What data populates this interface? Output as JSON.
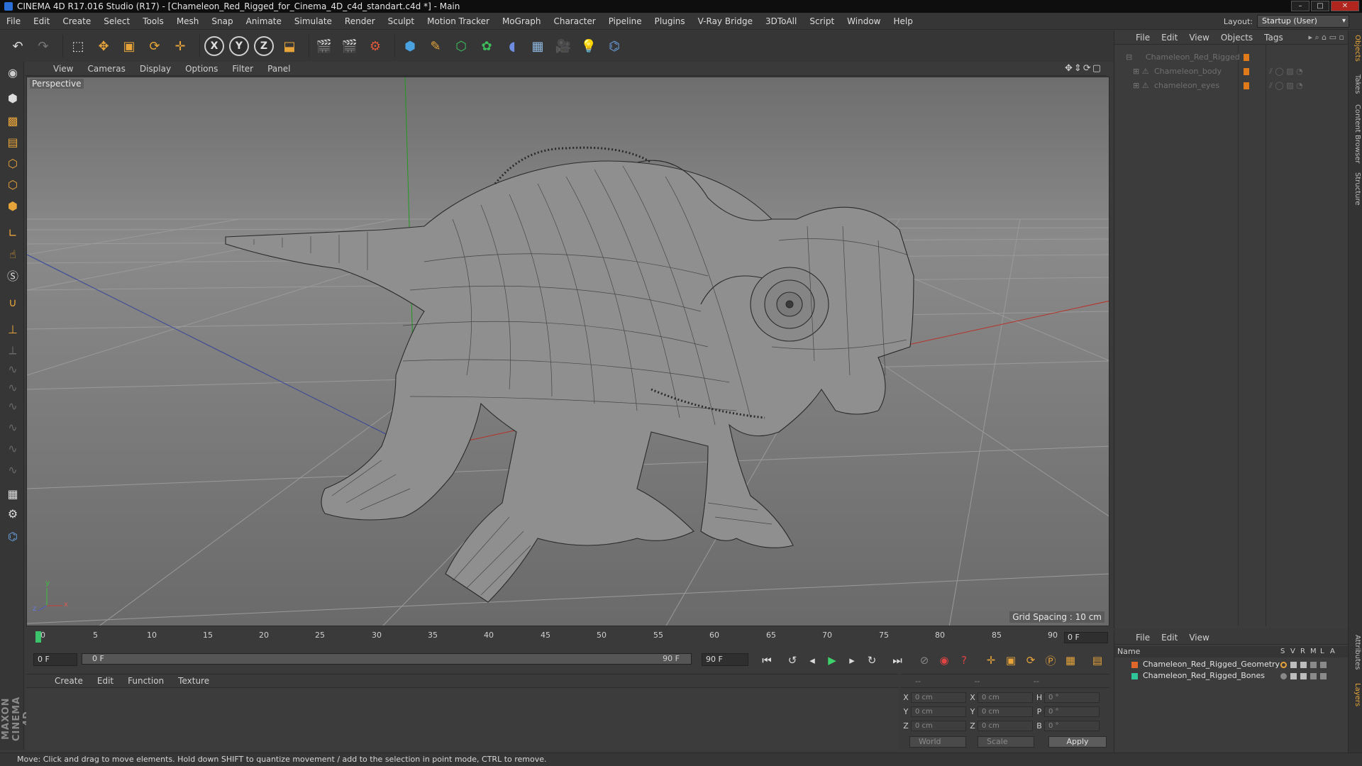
{
  "window": {
    "title": "CINEMA 4D R17.016 Studio (R17) - [Chameleon_Red_Rigged_for_Cinema_4D_c4d_standart.c4d *] - Main",
    "controls": [
      "–",
      "□",
      "✕"
    ]
  },
  "menubar": {
    "items": [
      "File",
      "Edit",
      "Create",
      "Select",
      "Tools",
      "Mesh",
      "Snap",
      "Animate",
      "Simulate",
      "Render",
      "Sculpt",
      "Motion Tracker",
      "MoGraph",
      "Character",
      "Pipeline",
      "Plugins",
      "V-Ray Bridge",
      "3DToAll",
      "Script",
      "Window",
      "Help"
    ],
    "layout_label": "Layout:",
    "layout_value": "Startup (User)"
  },
  "toolbar": {
    "axis_x": "X",
    "axis_y": "Y",
    "axis_z": "Z"
  },
  "viewport": {
    "menu": [
      "View",
      "Cameras",
      "Display",
      "Options",
      "Filter",
      "Panel"
    ],
    "label": "Perspective",
    "grid_spacing": "Grid Spacing : 10 cm",
    "axis_y": "y",
    "axis_z": "z",
    "axis_x": "x"
  },
  "timeline": {
    "ticks": [
      "0",
      "5",
      "10",
      "15",
      "20",
      "25",
      "30",
      "35",
      "40",
      "45",
      "50",
      "55",
      "60",
      "65",
      "70",
      "75",
      "80",
      "85",
      "90"
    ],
    "current_frame_field": "0 F",
    "start_field": "0 F",
    "range_start": "0 F",
    "range_end": "90 F",
    "end_field": "90 F"
  },
  "material_manager": {
    "menu": [
      "Create",
      "Edit",
      "Function",
      "Texture"
    ]
  },
  "coordinates": {
    "header": "--",
    "header2": "--",
    "header3": "--",
    "rows": [
      {
        "l1": "X",
        "v1": "0 cm",
        "l2": "X",
        "v2": "0 cm",
        "l3": "H",
        "v3": "0 °"
      },
      {
        "l1": "Y",
        "v1": "0 cm",
        "l2": "Y",
        "v2": "0 cm",
        "l3": "P",
        "v3": "0 °"
      },
      {
        "l1": "Z",
        "v1": "0 cm",
        "l2": "Z",
        "v2": "0 cm",
        "l3": "B",
        "v3": "0 °"
      }
    ],
    "space_select": "World",
    "mode_select": "Scale",
    "apply": "Apply"
  },
  "object_manager": {
    "menu": [
      "File",
      "Edit",
      "View",
      "Objects",
      "Tags"
    ],
    "objects": [
      {
        "name": "Chameleon_Red_Rigged"
      },
      {
        "name": "Chameleon_body"
      },
      {
        "name": "chameleon_eyes"
      }
    ]
  },
  "layer_manager": {
    "menu": [
      "File",
      "Edit",
      "View"
    ],
    "col_name": "Name",
    "cols": [
      "S",
      "V",
      "R",
      "M",
      "L",
      "A"
    ],
    "layers": [
      {
        "name": "Chameleon_Red_Rigged_Geometry",
        "color": "#e0662a"
      },
      {
        "name": "Chameleon_Red_Rigged_Bones",
        "color": "#2fc79a"
      }
    ]
  },
  "side_tabs": [
    "Objects",
    "Takes",
    "Content Browser",
    "Structure"
  ],
  "side_tabs_lower": [
    "Attributes",
    "Layers"
  ],
  "maxon_logo": "MAXON CINEMA 4D",
  "statusbar": {
    "text": "Move: Click and drag to move elements. Hold down SHIFT to quantize movement / add to the selection in point mode, CTRL to remove."
  },
  "colors": {
    "accent": "#e6a43a",
    "viewport_bg": "#7c7c7c",
    "play": "#3dd36a"
  }
}
